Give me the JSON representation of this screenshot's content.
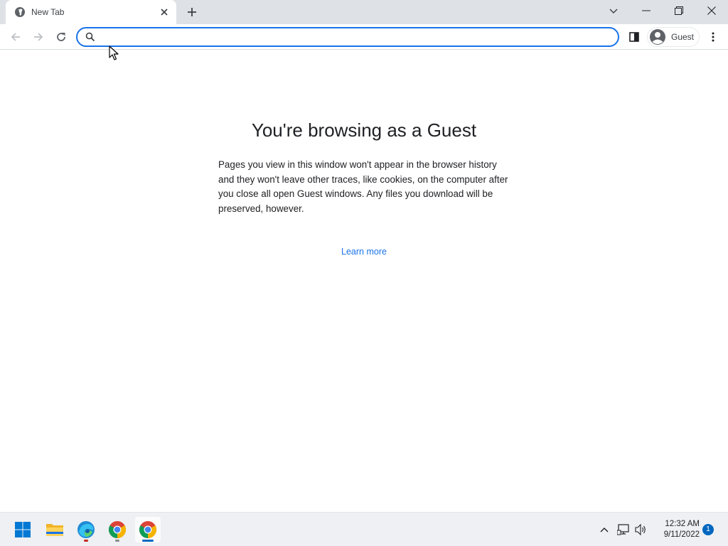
{
  "browser": {
    "tab": {
      "title": "New Tab"
    },
    "omnibox": {
      "value": "",
      "placeholder": ""
    },
    "profile": {
      "label": "Guest"
    },
    "accent_color": "#1a73e8"
  },
  "content": {
    "title": "You're browsing as a Guest",
    "description": "Pages you view in this window won't appear in the browser history and they won't leave other traces, like cookies, on the computer after you close all open Guest windows. Any files you download will be preserved, however.",
    "learn_more": "Learn more"
  },
  "taskbar": {
    "apps": [
      {
        "name": "start",
        "icon": "windows-logo-icon"
      },
      {
        "name": "file-explorer",
        "icon": "folder-icon"
      },
      {
        "name": "edge",
        "icon": "edge-icon",
        "indicator_color": "#c42b1c"
      },
      {
        "name": "chrome",
        "icon": "chrome-icon",
        "indicator_color": "#8a8a8a"
      },
      {
        "name": "chrome-active",
        "icon": "chrome-icon",
        "indicator_color": "#0067c0"
      }
    ],
    "clock": {
      "time": "12:32 AM",
      "date": "9/11/2022"
    },
    "notifications": "1"
  }
}
